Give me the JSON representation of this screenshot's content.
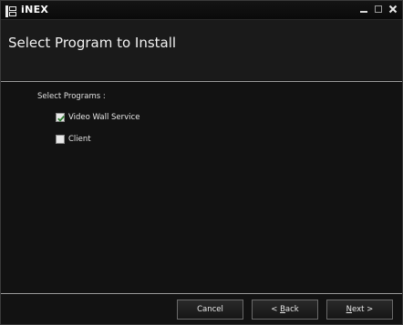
{
  "window": {
    "title": "iNEX",
    "icon": "app-logo-icon",
    "controls": [
      "minimize-icon",
      "maximize-icon",
      "close-icon"
    ]
  },
  "header": {
    "title": "Select Program to Install"
  },
  "content": {
    "label": "Select Programs :",
    "programs": [
      {
        "label": "Video Wall Service",
        "checked": true
      },
      {
        "label": "Client",
        "checked": false
      }
    ]
  },
  "footer": {
    "cancel_label": "Cancel",
    "back_prefix": "< ",
    "back_hotkey": "B",
    "back_rest": "ack",
    "next_hotkey": "N",
    "next_rest": "ext >"
  },
  "colors": {
    "background": "#121212",
    "titlebar": "#0a0a0a",
    "check_accent": "#2e7d32"
  }
}
